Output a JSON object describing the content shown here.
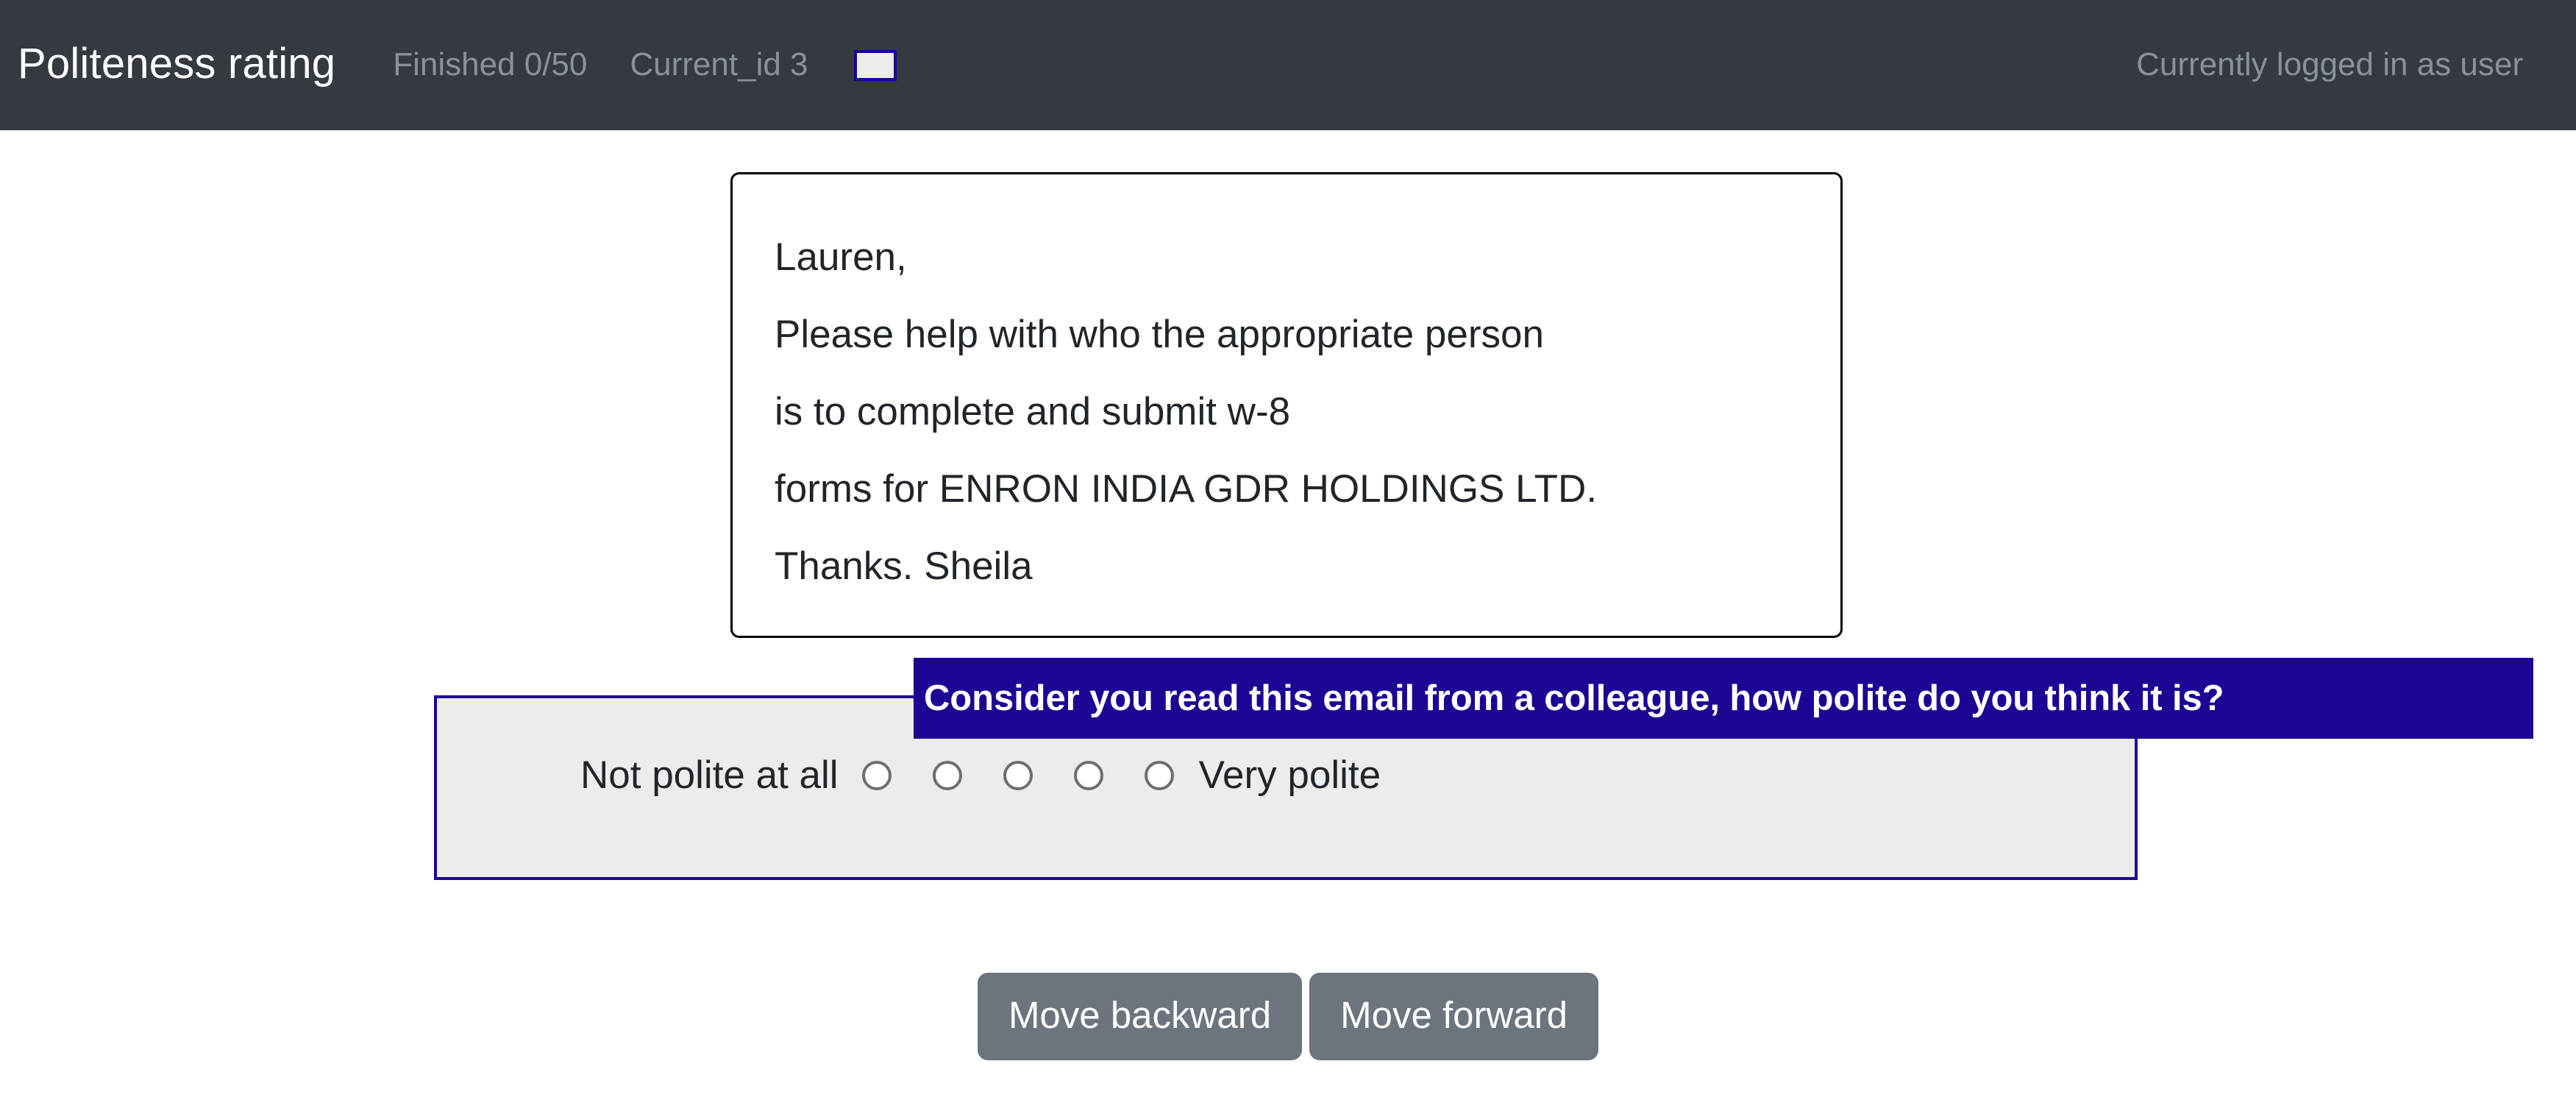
{
  "navbar": {
    "brand": "Politeness rating",
    "finished_label": "Finished 0/50",
    "current_id_label": "Current_id 3",
    "id_input_value": "",
    "id_input_placeholder": "",
    "logged_in_text": "Currently logged in as user",
    "background_color": "#343a40",
    "muted_text_color": "#8b9199"
  },
  "email": {
    "lines": [
      "Lauren,",
      "Please help with who the appropriate person",
      "is to complete and submit w-8",
      "forms for ENRON INDIA GDR HOLDINGS LTD.",
      "Thanks. Sheila"
    ]
  },
  "question": {
    "legend": "Consider you read this email from a colleague, how polite do you think it is?",
    "legend_background_color": "#1d0494",
    "fieldset_background_color": "#ececec",
    "low_label": "Not polite at all",
    "high_label": "Very polite",
    "options": [
      {
        "value": "1",
        "checked": false
      },
      {
        "value": "2",
        "checked": false
      },
      {
        "value": "3",
        "checked": false
      },
      {
        "value": "4",
        "checked": false
      },
      {
        "value": "5",
        "checked": false
      }
    ]
  },
  "actions": {
    "move_backward_label": "Move backward",
    "move_forward_label": "Move forward",
    "button_color": "#6c757d"
  }
}
